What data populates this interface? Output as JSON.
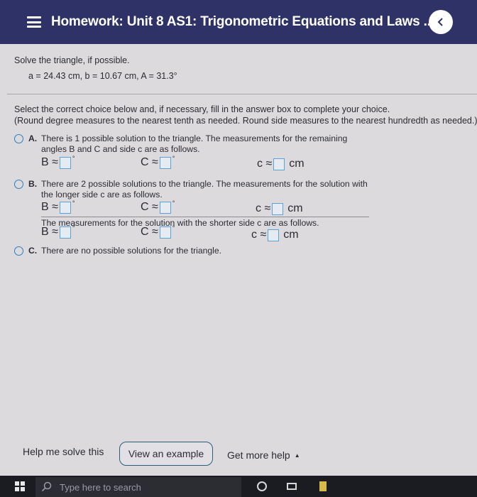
{
  "header": {
    "title": "Homework: Unit 8 AS1: Trigonometric Equations and Laws ...",
    "back_icon": "chevron-left-icon",
    "menu_icon": "hamburger-menu-icon"
  },
  "problem": {
    "prompt": "Solve the triangle, if possible.",
    "givens": "a = 24.43 cm, b = 10.67 cm, A = 31.3°"
  },
  "instructions": {
    "line1": "Select the correct choice below and, if necessary, fill in the answer box to complete your choice.",
    "line2": "(Round degree measures to the nearest tenth as needed. Round side measures to the nearest hundredth as needed.)"
  },
  "choices": {
    "a": {
      "letter": "A.",
      "line1": "There is 1 possible solution to the triangle. The measurements for the remaining",
      "line2": "angles B and C and side c are as follows."
    },
    "b": {
      "letter": "B.",
      "line1": "There are 2 possible solutions to the triangle. The measurements for the solution with",
      "line2": "the longer side c are as follows.",
      "line3": "The measurements for the solution with the shorter side c are as follows."
    },
    "c": {
      "letter": "C.",
      "line1": "There are no possible solutions for the triangle."
    }
  },
  "labels": {
    "B": "B ≈",
    "C": "C ≈",
    "c": "c ≈",
    "deg": "°",
    "cm": "cm"
  },
  "footer": {
    "help_label": "Help me solve this",
    "example_button": "View an example",
    "more_help": "Get more help",
    "more_help_icon": "caret-up-icon"
  },
  "taskbar": {
    "search_placeholder": "Type here to search"
  },
  "colors": {
    "header_bg": "#2e3266",
    "radio_accent": "#2a7fc4",
    "input_border": "#5aa3d9"
  }
}
